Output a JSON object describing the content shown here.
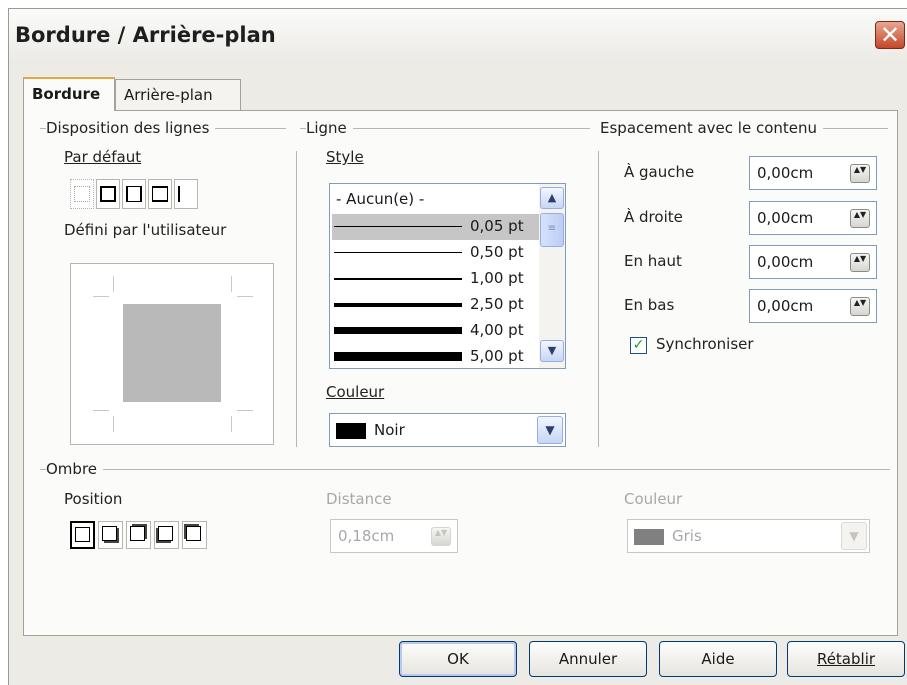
{
  "window": {
    "title": "Bordure / Arrière-plan",
    "close_glyph": "✕"
  },
  "tabs": [
    {
      "label": "Bordure",
      "active": true
    },
    {
      "label": "Arrière-plan",
      "active": false
    }
  ],
  "line_arrangement": {
    "title": "Disposition des lignes",
    "default_label": "Par défaut",
    "user_defined_label": "Défini par l'utilisateur"
  },
  "line": {
    "title": "Ligne",
    "style_label": "Style",
    "styles": [
      {
        "label": "- Aucun(e) -"
      },
      {
        "label": "0,05 pt",
        "selected": true
      },
      {
        "label": "0,50 pt"
      },
      {
        "label": "1,00 pt"
      },
      {
        "label": "2,50 pt"
      },
      {
        "label": "4,00 pt"
      },
      {
        "label": "5,00 pt"
      }
    ],
    "color_label": "Couleur",
    "color_value": "Noir",
    "color_swatch": "#000000"
  },
  "spacing": {
    "title": "Espacement avec le contenu",
    "left_label": "À gauche",
    "left_value": "0,00cm",
    "right_label": "À droite",
    "right_value": "0,00cm",
    "top_label": "En haut",
    "top_value": "0,00cm",
    "bottom_label": "En bas",
    "bottom_value": "0,00cm",
    "sync_label": "Synchroniser",
    "sync_checked": true
  },
  "shadow": {
    "title": "Ombre",
    "position_label": "Position",
    "distance_label": "Distance",
    "distance_value": "0,18cm",
    "color_label": "Couleur",
    "color_value": "Gris",
    "color_swatch": "#808080"
  },
  "buttons": {
    "ok": "OK",
    "cancel": "Annuler",
    "help": "Aide",
    "reset": "Rétablir"
  },
  "icons": {
    "scroll_up": "▲",
    "scroll_down": "▼",
    "dropdown": "▼",
    "spin": "▲▼",
    "check": "✓",
    "thumb_grip": "≡"
  }
}
